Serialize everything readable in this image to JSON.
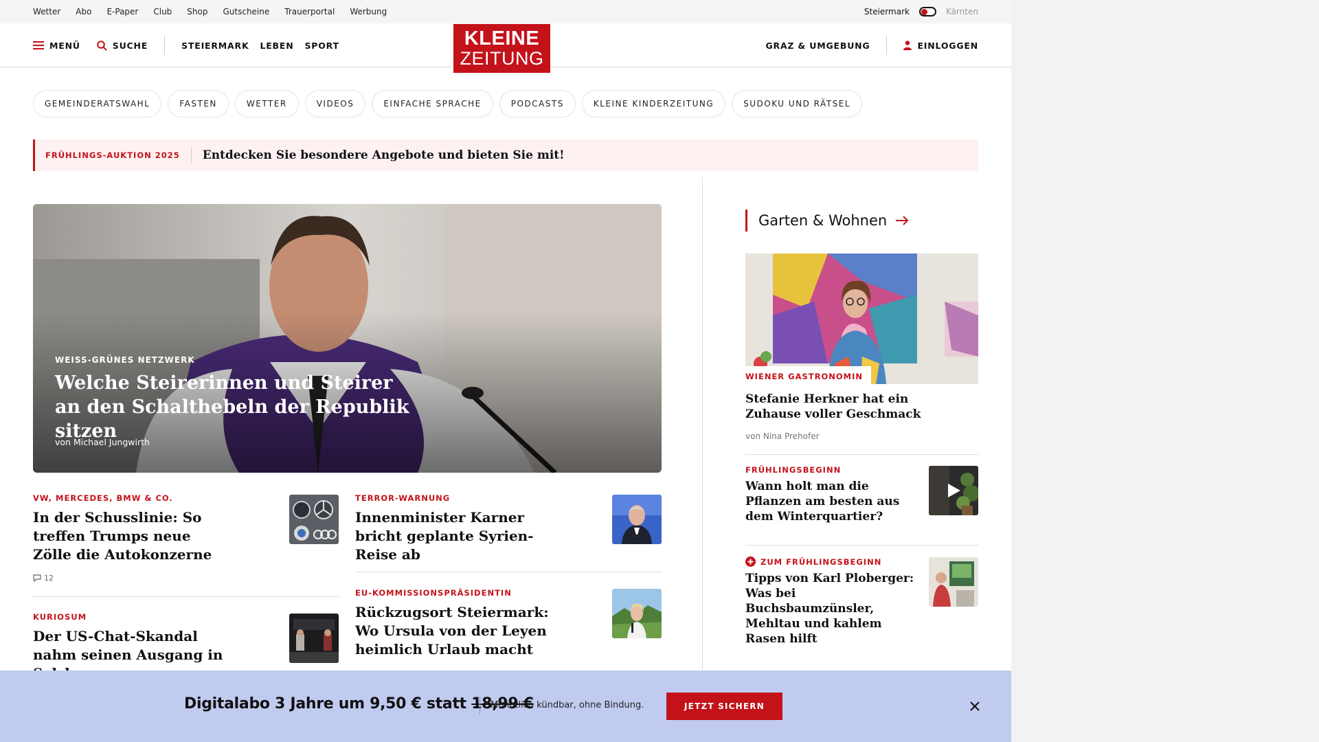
{
  "topbar": {
    "links": [
      "Wetter",
      "Abo",
      "E-Paper",
      "Club",
      "Shop",
      "Gutscheine",
      "Trauerportal",
      "Werbung"
    ],
    "region_active": "Steiermark",
    "region_inactive": "Kärnten"
  },
  "header": {
    "menu": "MENÜ",
    "search": "SUCHE",
    "nav": [
      "STEIERMARK",
      "LEBEN",
      "SPORT"
    ],
    "logo_line1": "KLEINE",
    "logo_line2": "ZEITUNG",
    "region_link": "GRAZ & UMGEBUNG",
    "login": "EINLOGGEN"
  },
  "pills": [
    "GEMEINDERATSWAHL",
    "FASTEN",
    "WETTER",
    "VIDEOS",
    "EINFACHE SPRACHE",
    "PODCASTS",
    "KLEINE KINDERZEITUNG",
    "SUDOKU UND RÄTSEL"
  ],
  "promo": {
    "tag": "FRÜHLINGS-AUKTION 2025",
    "text": "Entdecken Sie besondere Angebote und bieten Sie mit!"
  },
  "hero": {
    "kicker": "WEISS-GRÜNES NETZWERK",
    "title": "Welche Steirerinnen und Steirer an den Schalthebeln der Republik sitzen",
    "author": "von Michael Jungwirth"
  },
  "articles": {
    "a1": {
      "kicker": "VW, MERCEDES, BMW & CO.",
      "title": "In der Schusslinie: So treffen Trumps neue Zölle die Autokonzerne",
      "comments": "12"
    },
    "a2": {
      "kicker": "TERROR-WARNUNG",
      "title": "Innenminister Karner bricht geplante Syrien-Reise ab"
    },
    "a3": {
      "kicker": "KURIOSUM",
      "title": "Der US-Chat-Skandal nahm seinen Ausgang in Salzburg"
    },
    "a4": {
      "kicker": "EU-KOMMISSIONSPRÄSIDENTIN",
      "title": "Rückzugsort Steiermark: Wo Ursula von der Leyen heimlich Urlaub macht"
    }
  },
  "sidebar": {
    "section_title": "Garten & Wohnen",
    "feature": {
      "kicker": "WIENER GASTRONOMIN",
      "title": "Stefanie Herkner hat ein Zuhause voller Geschmack",
      "author": "von Nina Prehofer"
    },
    "item1": {
      "kicker": "FRÜHLINGSBEGINN",
      "title": "Wann holt man die Pflanzen am besten aus dem Winterquartier?"
    },
    "item2": {
      "kicker": "ZUM FRÜHLINGSBEGINN",
      "title": "Tipps von Karl Ploberger: Was bei Buchsbaumzünsler, Mehltau und kahlem Rasen hilft"
    }
  },
  "offer": {
    "text_prefix": "Digitalabo 3 Jahre um 9,50 € statt ",
    "old_price": "18,99 €",
    "note": "Monatlich kündbar, ohne Bindung.",
    "button": "JETZT SICHERN"
  },
  "colors": {
    "brand_red": "#c4121a",
    "offer_bg": "#c1cbf0",
    "promo_bg": "#fdf1f2"
  },
  "icons": [
    "menu-icon",
    "search-icon",
    "user-icon",
    "arrow-right-icon",
    "comment-icon",
    "play-icon",
    "plus-circle-icon",
    "close-icon"
  ]
}
